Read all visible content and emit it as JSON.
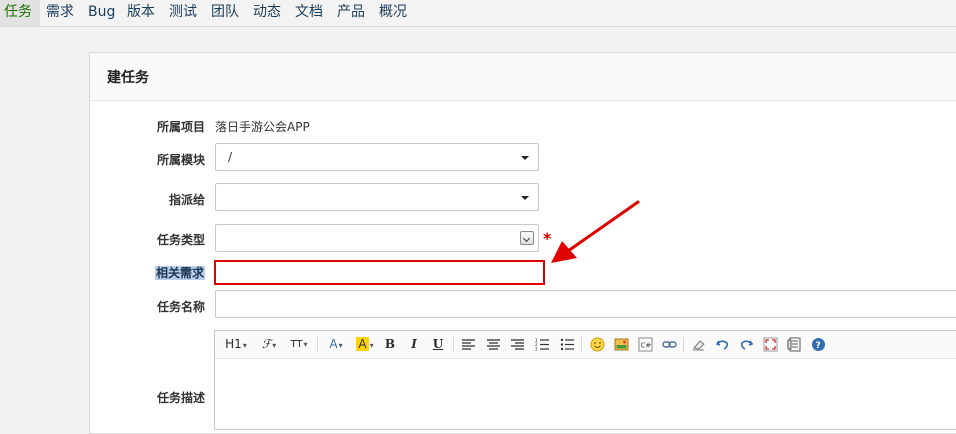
{
  "nav": {
    "items": [
      "任务",
      "需求",
      "Bug",
      "版本",
      "测试",
      "团队",
      "动态",
      "文档",
      "产品",
      "概况"
    ],
    "active": "任务"
  },
  "panel": {
    "title": "建任务"
  },
  "form": {
    "project_label": "所属项目",
    "project_value": "落日手游公会APP",
    "module_label": "所属模块",
    "module_value": "/",
    "assign_label": "指派给",
    "assign_value": "",
    "type_label": "任务类型",
    "type_value": "",
    "required_mark": "*",
    "story_label": "相关需求",
    "name_label": "任务名称",
    "name_value": "",
    "desc_label": "任务描述"
  },
  "editor_toolbar": {
    "heading": "H1",
    "font_family": "ℱ",
    "font_size": "TT",
    "font_color": "A",
    "bg_color": "A",
    "bold": "B",
    "italic": "I",
    "underline": "U"
  },
  "colors": {
    "accent_red": "#e00000",
    "nav_active_text": "#1a6e00",
    "selection_bg": "#b9cfe8",
    "link_blue": "#1c3d5a"
  }
}
